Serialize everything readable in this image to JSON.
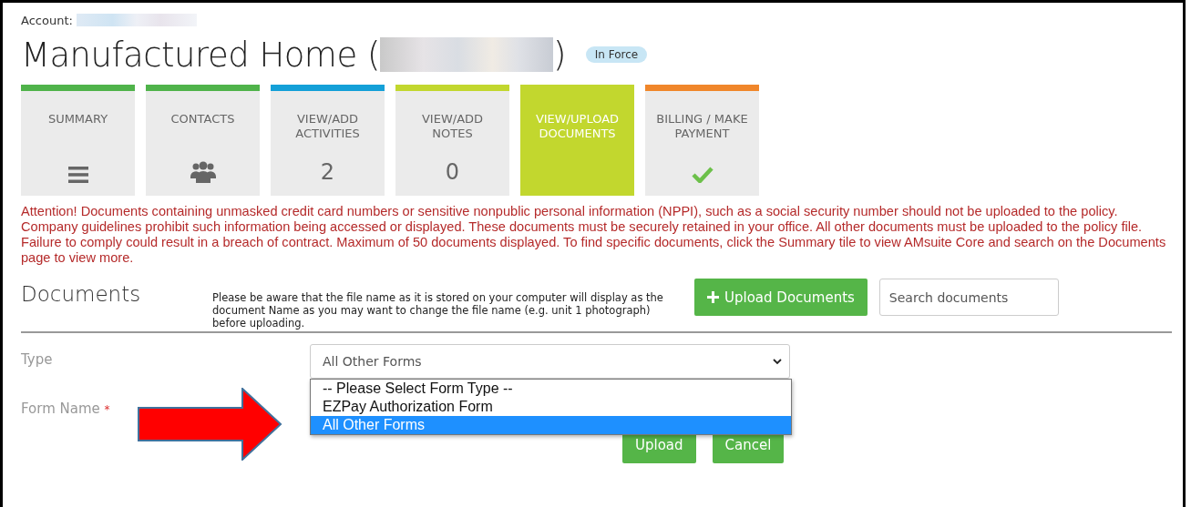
{
  "account": {
    "label": "Account:",
    "value_redacted": true
  },
  "header": {
    "title_start": "Manufactured Home (",
    "title_end": ")",
    "title_redacted": true,
    "status": "In Force"
  },
  "tiles": [
    {
      "label": "SUMMARY",
      "color": "#4fb34a",
      "selected": false,
      "kind": "menu"
    },
    {
      "label": "CONTACTS",
      "color": "#4fb34a",
      "selected": false,
      "kind": "people"
    },
    {
      "label": "VIEW/ADD ACTIVITIES",
      "color": "#14a0d8",
      "selected": false,
      "kind": "count",
      "count": "2"
    },
    {
      "label": "VIEW/ADD NOTES",
      "color": "#c2d72e",
      "selected": false,
      "kind": "count",
      "count": "0"
    },
    {
      "label": "VIEW/UPLOAD DOCUMENTS",
      "color": "#c2d72e",
      "selected": true,
      "kind": "none"
    },
    {
      "label": "BILLING / MAKE PAYMENT",
      "color": "#f0862a",
      "selected": false,
      "kind": "check"
    }
  ],
  "warning": "Attention! Documents containing unmasked credit card numbers or sensitive nonpublic personal information (NPPI), such as a social security number should not be uploaded to the policy. Company guidelines prohibit such information being accessed or displayed. These documents must be securely retained in your office. All other documents must be uploaded to the policy file. Failure to comply could result in a breach of contract. Maximum of 50 documents displayed.  To find specific documents, click the Summary tile to view AMsuite Core and search on the Documents page to view more.",
  "documents": {
    "title": "Documents",
    "note": "Please be aware that the file name as it is stored on your computer will display as the document Name as you may want to change the file name (e.g. unit 1 photograph) before uploading.",
    "upload_button": "Upload Documents",
    "search": {
      "placeholder": "Search documents"
    }
  },
  "form": {
    "type_label": "Type",
    "type_value": "All Other Forms",
    "form_name_label": "Form Name",
    "required_mark": "*",
    "dropdown": {
      "expanded": true,
      "options": [
        {
          "label": "-- Please Select Form Type --",
          "selected": false
        },
        {
          "label": "EZPay Authorization Form",
          "selected": false
        },
        {
          "label": "All Other Forms",
          "selected": true
        }
      ]
    },
    "buttons": [
      "Upload",
      "Cancel"
    ]
  },
  "annotation": {
    "kind": "arrow"
  }
}
